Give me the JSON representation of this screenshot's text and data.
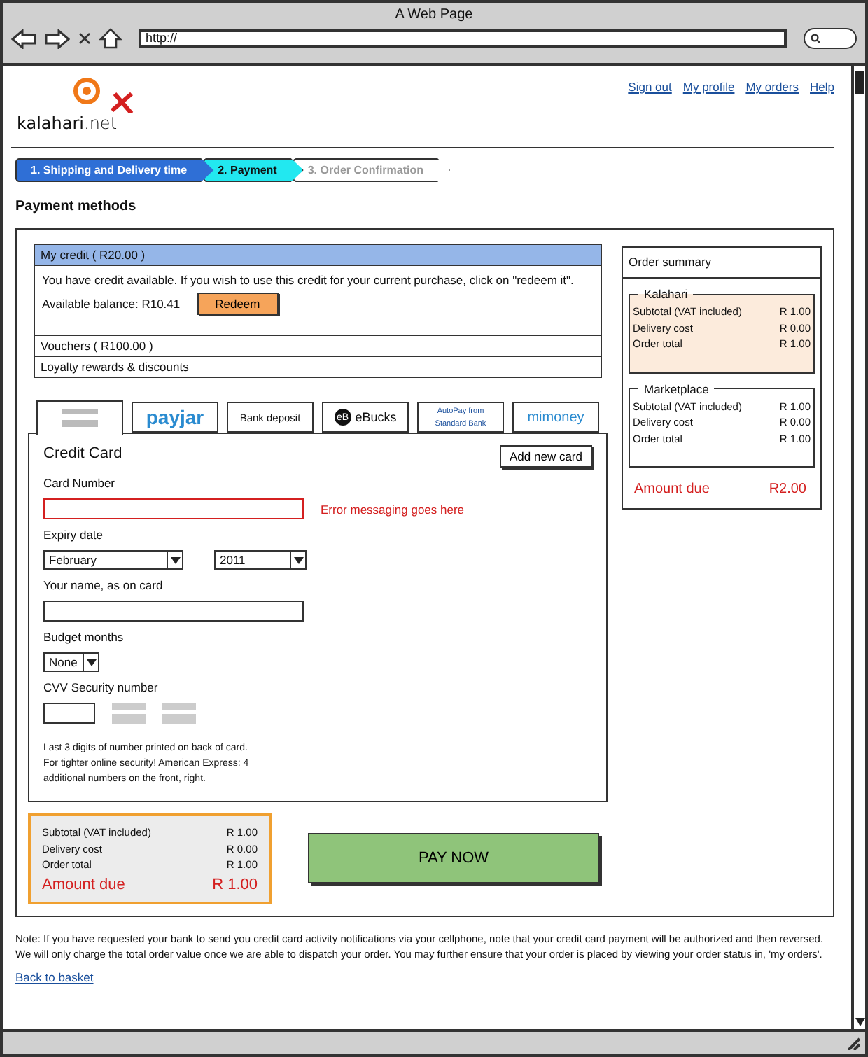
{
  "window": {
    "title": "A Web Page",
    "url": "http://"
  },
  "header": {
    "logo": {
      "name": "kalahari",
      "suffix": ".net"
    },
    "links": [
      "Sign out",
      "My profile",
      "My orders",
      "Help"
    ]
  },
  "steps": [
    {
      "label": "1. Shipping and Delivery time",
      "completed": true,
      "selected": false
    },
    {
      "label": "2. Payment",
      "completed": false,
      "selected": true
    },
    {
      "label": "3. Order Confirmation",
      "completed": false,
      "selected": false
    }
  ],
  "heading": "Payment methods",
  "credit_sections": [
    {
      "title": "My credit ( R20.00 )",
      "expanded": true,
      "message": "You have credit available. If you wish to use this credit for your current purchase, click on \"redeem it\".",
      "balance": "Available balance: R10.41",
      "button": "Redeem"
    },
    {
      "title": "Vouchers ( R100.00 )",
      "expanded": false
    },
    {
      "title": "Loyalty rewards & discounts",
      "expanded": false
    }
  ],
  "payment_tabs": [
    {
      "kind": "image",
      "selected": true
    },
    {
      "kind": "payjar",
      "label": "payjar",
      "selected": false
    },
    {
      "kind": "text",
      "label": "Bank deposit",
      "selected": false
    },
    {
      "kind": "ebucks",
      "badge": "eB",
      "label": "eBucks",
      "selected": false
    },
    {
      "kind": "autopay",
      "label": "AutoPay from",
      "sublabel": "Standard Bank",
      "selected": false
    },
    {
      "kind": "mimoney",
      "label": "mimoney",
      "selected": false
    }
  ],
  "credit_card": {
    "title": "Credit Card",
    "add_button": "Add new card",
    "fields": [
      {
        "kind": "text",
        "label": "Card Number",
        "invalid": true,
        "error": "Error messaging goes here"
      },
      {
        "kind": "selects",
        "label": "Expiry date",
        "values": [
          "February",
          "2011"
        ]
      },
      {
        "kind": "text",
        "label": "Your name, as on card",
        "invalid": false
      },
      {
        "kind": "selects",
        "label": "Budget months",
        "values": [
          "None"
        ]
      },
      {
        "kind": "cvv",
        "label": "CVV Security number",
        "hint": "Last 3 digits of number printed on back of card. For tighter online security! American Express: 4 additional numbers on the front, right."
      }
    ]
  },
  "totals": {
    "rows": [
      {
        "label": "Subtotal (VAT included)",
        "value": "R 1.00"
      },
      {
        "label": "Delivery cost",
        "value": "R 0.00"
      },
      {
        "label": "Order total",
        "value": "R 1.00"
      }
    ],
    "amount_label": "Amount due",
    "amount": "R 1.00"
  },
  "pay_button": "PAY NOW",
  "order_summary": {
    "title": "Order summary",
    "groups": [
      {
        "name": "Kalahari",
        "highlighted": true,
        "rows": [
          {
            "label": "Subtotal (VAT included)",
            "value": "R 1.00"
          },
          {
            "label": "Delivery cost",
            "value": "R 0.00"
          },
          {
            "label": "Order total",
            "value": "R 1.00"
          }
        ]
      },
      {
        "name": "Marketplace",
        "highlighted": false,
        "rows": [
          {
            "label": "Subtotal (VAT included)",
            "value": "R 1.00"
          },
          {
            "label": "Delivery cost",
            "value": "R 0.00"
          },
          {
            "label": "Order total",
            "value": "R 1.00"
          }
        ]
      }
    ],
    "amount_label": "Amount due",
    "amount": "R2.00"
  },
  "note": "Note: If you have requested your bank to send you credit card activity notifications via your cellphone, note that your credit card payment will be authorized and then reversed. We will only charge the total order value once we are able to dispatch your order. You may further ensure that your order is placed by viewing your order status in, 'my orders'.",
  "back_link": "Back to basket"
}
